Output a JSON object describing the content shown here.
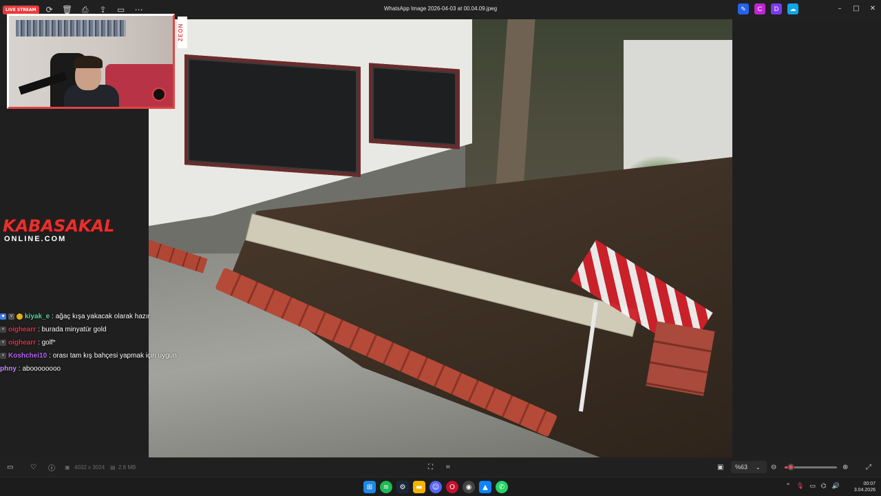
{
  "window": {
    "title": "WhatsApp Image 2026-04-03 at 00.04.09.jpeg",
    "live_badge": "LIVE STREAM",
    "controls": {
      "minimize": "–",
      "maximize": "□",
      "close": "✕"
    }
  },
  "toolbar": {
    "icons": [
      "rotate-icon",
      "trash-icon",
      "print-icon",
      "share-icon",
      "slideshow-icon",
      "more-icon"
    ],
    "right_icons": [
      "editor-icon",
      "clipchamp-icon",
      "designer-icon",
      "onedrive-icon"
    ]
  },
  "overlay": {
    "camera_side_label": "ZEON",
    "brand_top": "KABASAKAL",
    "brand_bottom": "ONLINE.COM"
  },
  "chat": [
    {
      "user": "kiyak_e",
      "user_color": "#5bd4a5",
      "text": ": ağaç kışa yakacak olarak hazır"
    },
    {
      "user": "oighearr",
      "user_color": "#e0324a",
      "text": ": burada minyatür gold"
    },
    {
      "user": "oighearr",
      "user_color": "#e0324a",
      "text": ": golf*"
    },
    {
      "user": "Koshchei10",
      "user_color": "#b463f0",
      "text": ": orası tam kış bahçesi yapmak için uygun"
    },
    {
      "user": "phny",
      "user_color": "#c58cff",
      "text": ": aboooooooo"
    }
  ],
  "statusbar": {
    "dimensions": "4032 x 3024",
    "filesize": "2.8 MB",
    "zoom": "%63",
    "zoom_level": 0.12
  },
  "taskbar": {
    "icons": [
      "windows-icon",
      "spotify-icon",
      "steam-icon",
      "file-explorer-icon",
      "discord-icon",
      "opera-gx-icon",
      "chrome-icon",
      "photos-icon",
      "whatsapp-icon"
    ],
    "time": "00:07",
    "date": "3.04.2026"
  }
}
